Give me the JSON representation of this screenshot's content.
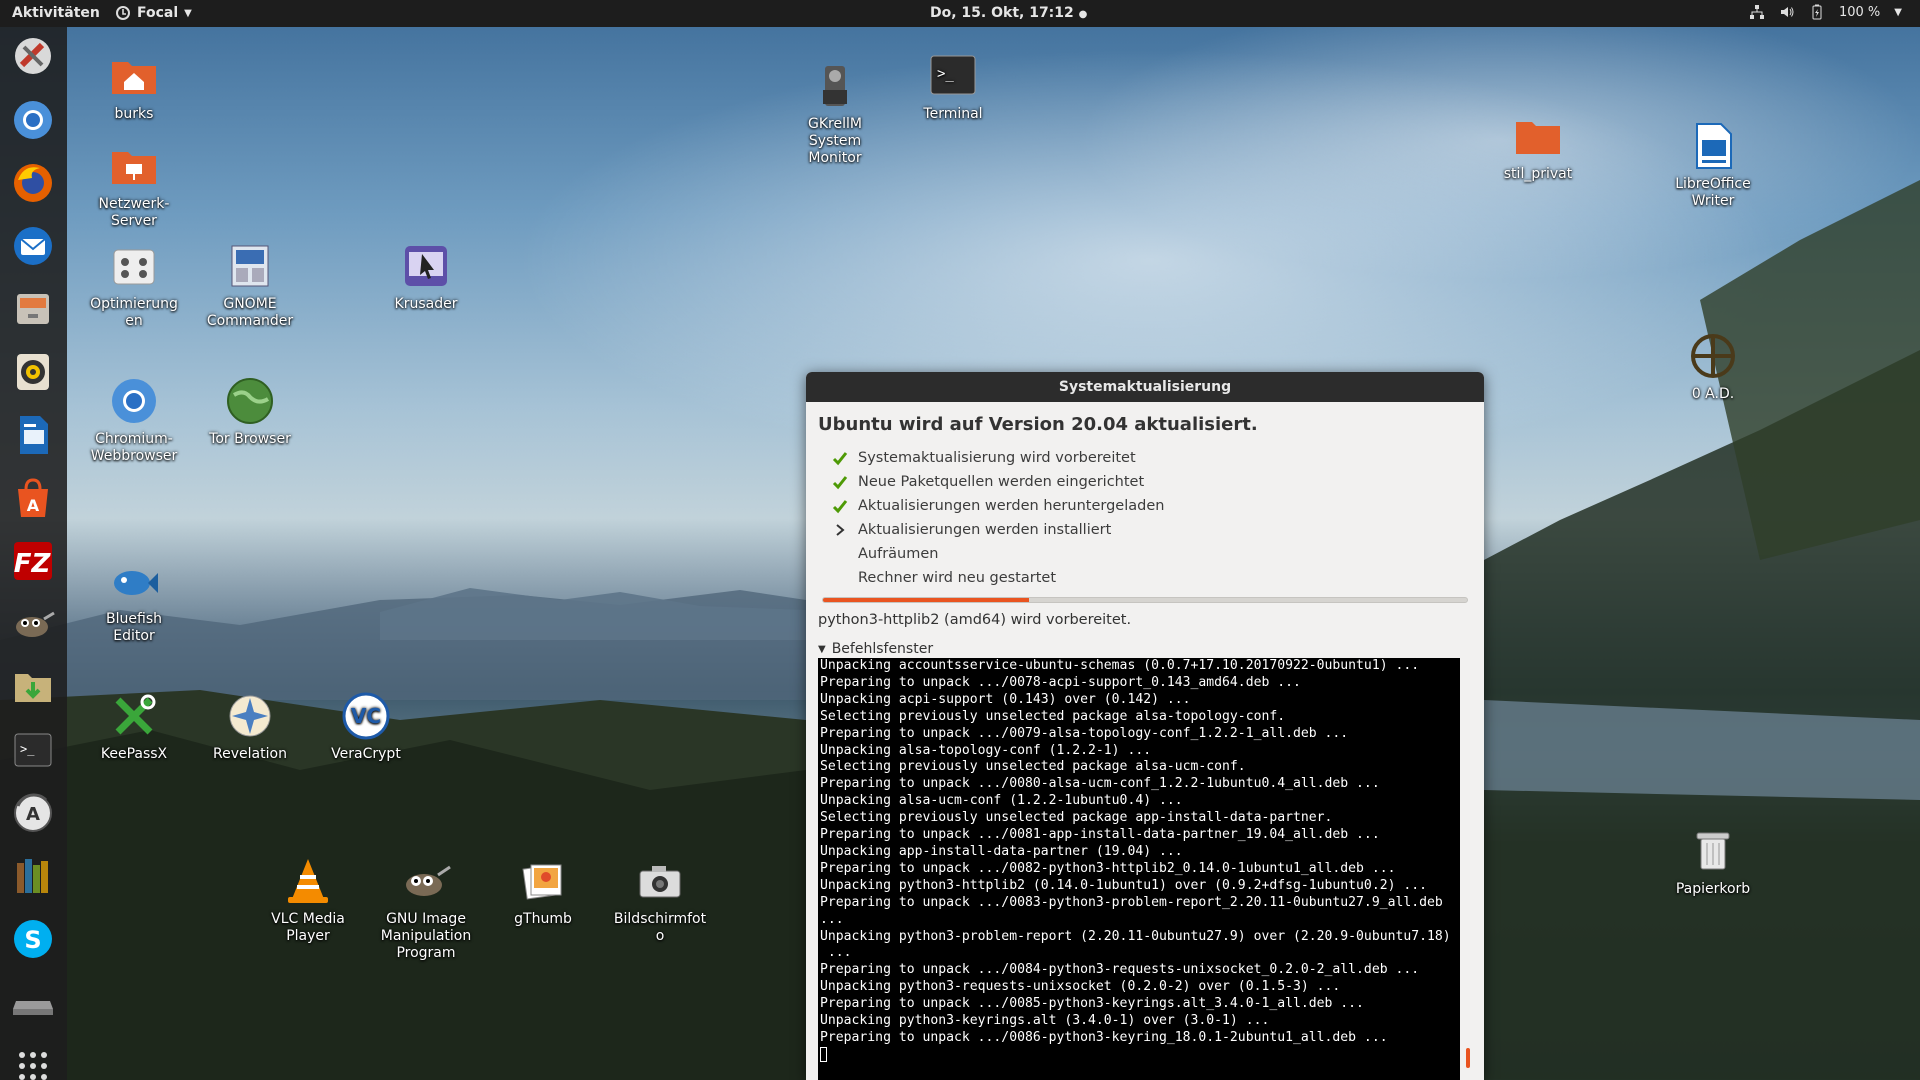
{
  "topbar": {
    "activities": "Aktivitäten",
    "app_menu": "Focal",
    "clock": "Do, 15. Okt, 17:12",
    "battery": "100 %"
  },
  "dock": [
    {
      "name": "updates-tool-icon"
    },
    {
      "name": "chromium-icon"
    },
    {
      "name": "firefox-icon"
    },
    {
      "name": "thunderbird-icon"
    },
    {
      "name": "file-cabinet-icon"
    },
    {
      "name": "rhythmbox-icon"
    },
    {
      "name": "libreoffice-writer-icon"
    },
    {
      "name": "software-center-icon"
    },
    {
      "name": "filezilla-icon"
    },
    {
      "name": "gimp-icon"
    },
    {
      "name": "download-folder-icon"
    },
    {
      "name": "terminal-icon"
    },
    {
      "name": "software-updater-icon"
    },
    {
      "name": "calibre-icon"
    },
    {
      "name": "skype-icon"
    },
    {
      "name": "drive-icon"
    },
    {
      "name": "app-grid-icon"
    }
  ],
  "desktop_icons": {
    "burks": "burks",
    "netzwerk": "Netzwerk-Server",
    "optimierungen": "Optimierungen",
    "gnome_commander": "GNOME Commander",
    "krusader": "Krusader",
    "chromium": "Chromium-Webbrowser",
    "tor": "Tor Browser",
    "bluefish": "Bluefish Editor",
    "keepassx": "KeePassX",
    "revelation": "Revelation",
    "veracrypt": "VeraCrypt",
    "vlc": "VLC Media Player",
    "gimp": "GNU Image Manipulation Program",
    "gthumb": "gThumb",
    "bildschirmfoto": "Bildschirmfoto",
    "gkrellm": "GKrellM System Monitor",
    "terminal": "Terminal",
    "stil_privat": "stil_privat",
    "libreoffice_writer": "LibreOffice Writer",
    "zero_ad": "0 A.D.",
    "papierkorb": "Papierkorb"
  },
  "dialog": {
    "title": "Systemaktualisierung",
    "heading": "Ubuntu wird auf Version 20.04 aktualisiert.",
    "steps": [
      {
        "label": "Systemaktualisierung wird vorbereitet",
        "state": "done"
      },
      {
        "label": "Neue Paketquellen werden eingerichtet",
        "state": "done"
      },
      {
        "label": "Aktualisierungen werden heruntergeladen",
        "state": "done"
      },
      {
        "label": "Aktualisierungen werden installiert",
        "state": "active"
      },
      {
        "label": "Aufräumen",
        "state": "pending"
      },
      {
        "label": "Rechner wird neu gestartet",
        "state": "pending"
      }
    ],
    "progress": 0.32,
    "status": "python3-httplib2 (amd64) wird vorbereitet.",
    "terminal_label": "Befehlsfenster",
    "terminal_lines": [
      "Unpacking accountsservice-ubuntu-schemas (0.0.7+17.10.20170922-0ubuntu1) ...",
      "Preparing to unpack .../0078-acpi-support_0.143_amd64.deb ...",
      "Unpacking acpi-support (0.143) over (0.142) ...",
      "Selecting previously unselected package alsa-topology-conf.",
      "Preparing to unpack .../0079-alsa-topology-conf_1.2.2-1_all.deb ...",
      "Unpacking alsa-topology-conf (1.2.2-1) ...",
      "Selecting previously unselected package alsa-ucm-conf.",
      "Preparing to unpack .../0080-alsa-ucm-conf_1.2.2-1ubuntu0.4_all.deb ...",
      "Unpacking alsa-ucm-conf (1.2.2-1ubuntu0.4) ...",
      "Selecting previously unselected package app-install-data-partner.",
      "Preparing to unpack .../0081-app-install-data-partner_19.04_all.deb ...",
      "Unpacking app-install-data-partner (19.04) ...",
      "Preparing to unpack .../0082-python3-httplib2_0.14.0-1ubuntu1_all.deb ...",
      "Unpacking python3-httplib2 (0.14.0-1ubuntu1) over (0.9.2+dfsg-1ubuntu0.2) ...",
      "Preparing to unpack .../0083-python3-problem-report_2.20.11-0ubuntu27.9_all.deb",
      "...",
      "Unpacking python3-problem-report (2.20.11-0ubuntu27.9) over (2.20.9-0ubuntu7.18)",
      " ...",
      "Preparing to unpack .../0084-python3-requests-unixsocket_0.2.0-2_all.deb ...",
      "Unpacking python3-requests-unixsocket (0.2.0-2) over (0.1.5-3) ...",
      "Preparing to unpack .../0085-python3-keyrings.alt_3.4.0-1_all.deb ...",
      "Unpacking python3-keyrings.alt (3.4.0-1) over (3.0-1) ...",
      "Preparing to unpack .../0086-python3-keyring_18.0.1-2ubuntu1_all.deb ..."
    ]
  }
}
